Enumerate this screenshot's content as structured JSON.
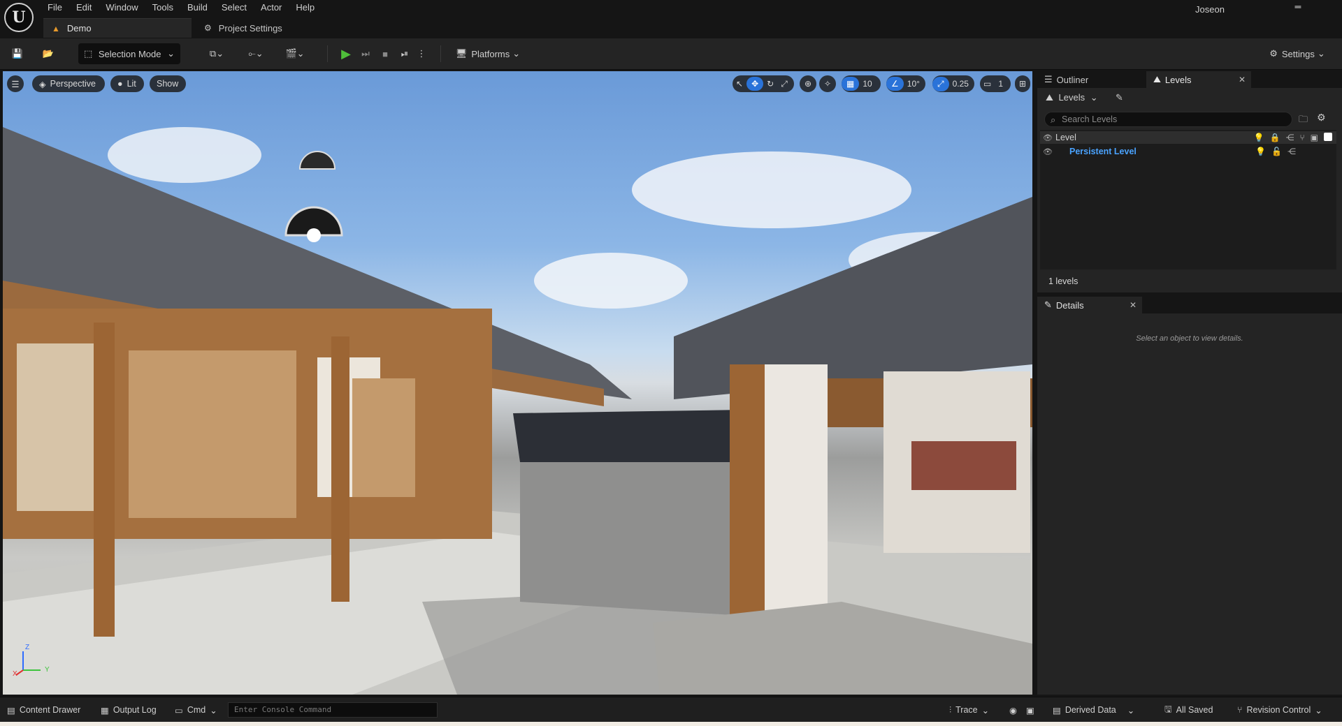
{
  "menu": [
    "File",
    "Edit",
    "Window",
    "Tools",
    "Build",
    "Select",
    "Actor",
    "Help"
  ],
  "tabs": {
    "demo": "Demo",
    "project_settings": "Project Settings"
  },
  "user": "Joseon",
  "toolbar": {
    "selection_mode": "Selection Mode",
    "platforms": "Platforms",
    "settings": "Settings"
  },
  "viewport": {
    "perspective": "Perspective",
    "lit": "Lit",
    "show": "Show",
    "grid_snap": "10",
    "rotation_snap": "10°",
    "scale_snap": "0.25",
    "camera_speed": "1",
    "axis_z": "Z",
    "axis_x": "X",
    "axis_y": "Y"
  },
  "panels": {
    "outliner_tab": "Outliner",
    "levels_tab": "Levels",
    "levels_dropdown": "Levels",
    "search_placeholder": "Search Levels",
    "column_level": "Level",
    "rows": [
      {
        "name": "Persistent Level"
      }
    ],
    "count": "1 levels",
    "details_tab": "Details",
    "details_empty": "Select an object to view details."
  },
  "status": {
    "content_drawer": "Content Drawer",
    "output_log": "Output Log",
    "cmd": "Cmd",
    "console_placeholder": "Enter Console Command",
    "trace": "Trace",
    "derived_data": "Derived Data",
    "all_saved": "All Saved",
    "revision_control": "Revision Control"
  },
  "colors": {
    "accent": "#2a73d9",
    "play": "#4fbf3a",
    "level_link": "#4aa3ff",
    "tab_icon": "#e89a2c"
  }
}
